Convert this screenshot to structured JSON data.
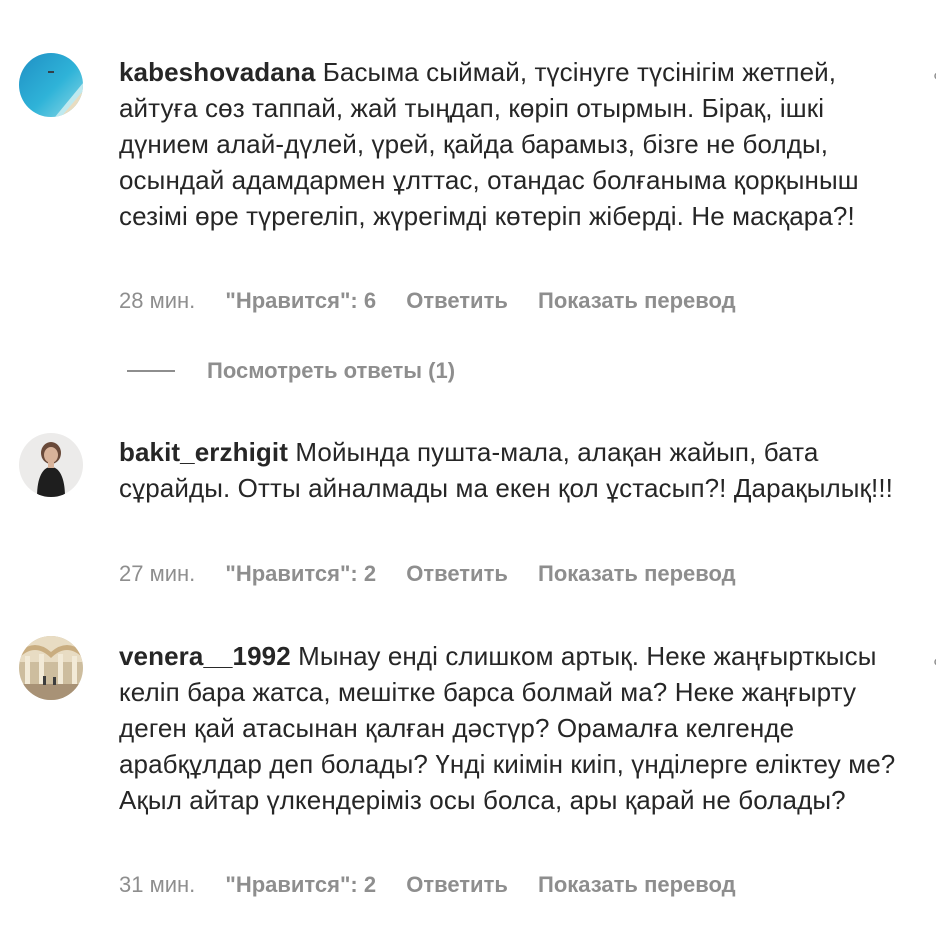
{
  "comments": [
    {
      "username": "kabeshovadana",
      "text": "Басыма сыймай, түсінуге түсінігім жетпей, айтуға сөз таппай, жай тыңдап, көріп отырмын. Бірақ, ішкі дүнием алай-дүлей, үрей, қайда барамыз, бізге не болды, осындай адамдармен ұлттас, отандас болғаныма қорқыныш сезімі өре түрегеліп, жүрегімді көтеріп жіберді. Не масқара?!",
      "time": "28 мин.",
      "likes": "\"Нравится\": 6",
      "reply": "Ответить",
      "translate": "Показать перевод",
      "avatar_icon": "beach-photo-avatar"
    },
    {
      "username": "bakit_erzhigit",
      "text": "Мойында пушта-мала, алақан жайып, бата сұрайды. Отты айналмады ма екен қол ұстасып?! Дарақылық!!!",
      "time": "27 мин.",
      "likes": "\"Нравится\": 2",
      "reply": "Ответить",
      "translate": "Показать перевод",
      "avatar_icon": "woman-portrait-avatar"
    },
    {
      "username": "venera__1992",
      "text": "Мынау енді слишком артық. Неке жаңғырткысы келіп бара жатса, мешітке барса болмай ма? Неке жаңғырту деген қай атасынан қалған дәстүр? Орамалға келгенде арабқұлдар деп болады? Үнді киімін киіп, үнділерге еліктеу ме? Ақыл айтар үлкендеріміз осы болса, ары қарай не болады?",
      "time": "31 мин.",
      "likes": "\"Нравится\": 2",
      "reply": "Ответить",
      "translate": "Показать перевод",
      "avatar_icon": "mosque-interior-avatar"
    }
  ],
  "view_replies": {
    "label": "Посмотреть ответы (1)"
  },
  "icons": {
    "options": "more-options-icon"
  },
  "colors": {
    "text": "#262626",
    "secondary": "#8e8e8e",
    "background": "#ffffff"
  }
}
